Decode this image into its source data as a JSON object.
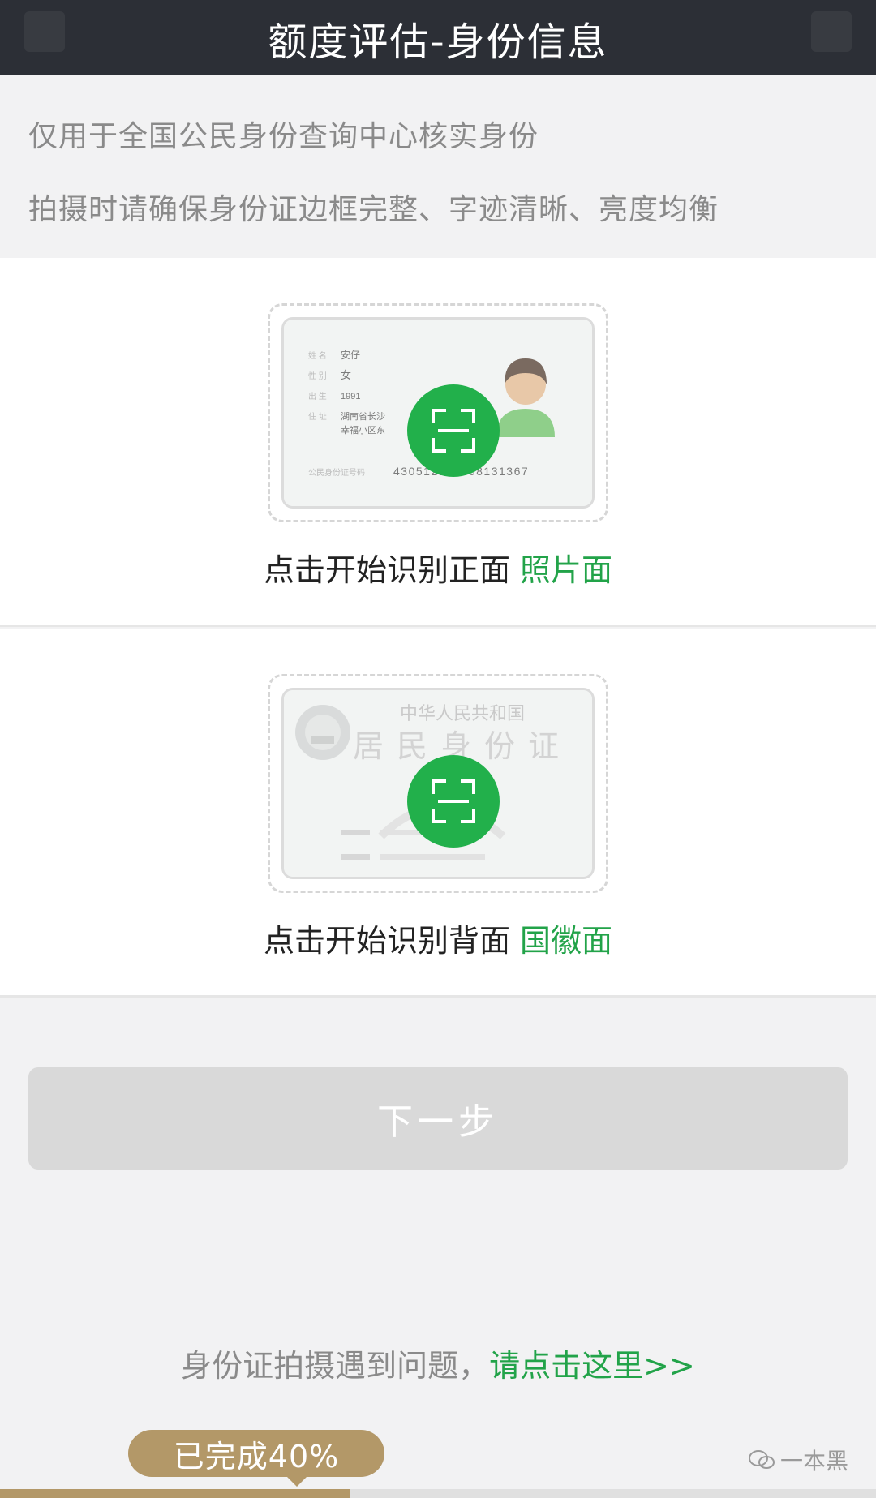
{
  "header": {
    "title": "额度评估-身份信息"
  },
  "notice": {
    "line1": "仅用于全国公民身份查询中心核实身份",
    "line2": "拍摄时请确保身份证边框完整、字迹清晰、亮度均衡"
  },
  "front": {
    "caption": "点击开始识别正面",
    "accent": "照片面",
    "card": {
      "name_value": "安仔",
      "sex_value": "女",
      "birth_value": "1991",
      "address_line1": "湖南省长沙",
      "address_line2": "幸福小区东",
      "id_number": "430512198908131367"
    }
  },
  "back": {
    "caption": "点击开始识别背面",
    "accent": "国徽面",
    "card": {
      "country": "中华人民共和国",
      "title": "居民身份证"
    }
  },
  "actions": {
    "next": "下一步"
  },
  "help": {
    "text": "身份证拍摄遇到问题，",
    "link": "请点击这里>>"
  },
  "progress": {
    "label": "已完成40%",
    "fraction": 0.4
  },
  "watermark": {
    "text": "一本黑"
  },
  "colors": {
    "header_bg": "#2c2f36",
    "accent_green": "#22a349",
    "scan_green": "#22b04b",
    "gold": "#b39868",
    "disabled_button": "#d9d9d9"
  }
}
